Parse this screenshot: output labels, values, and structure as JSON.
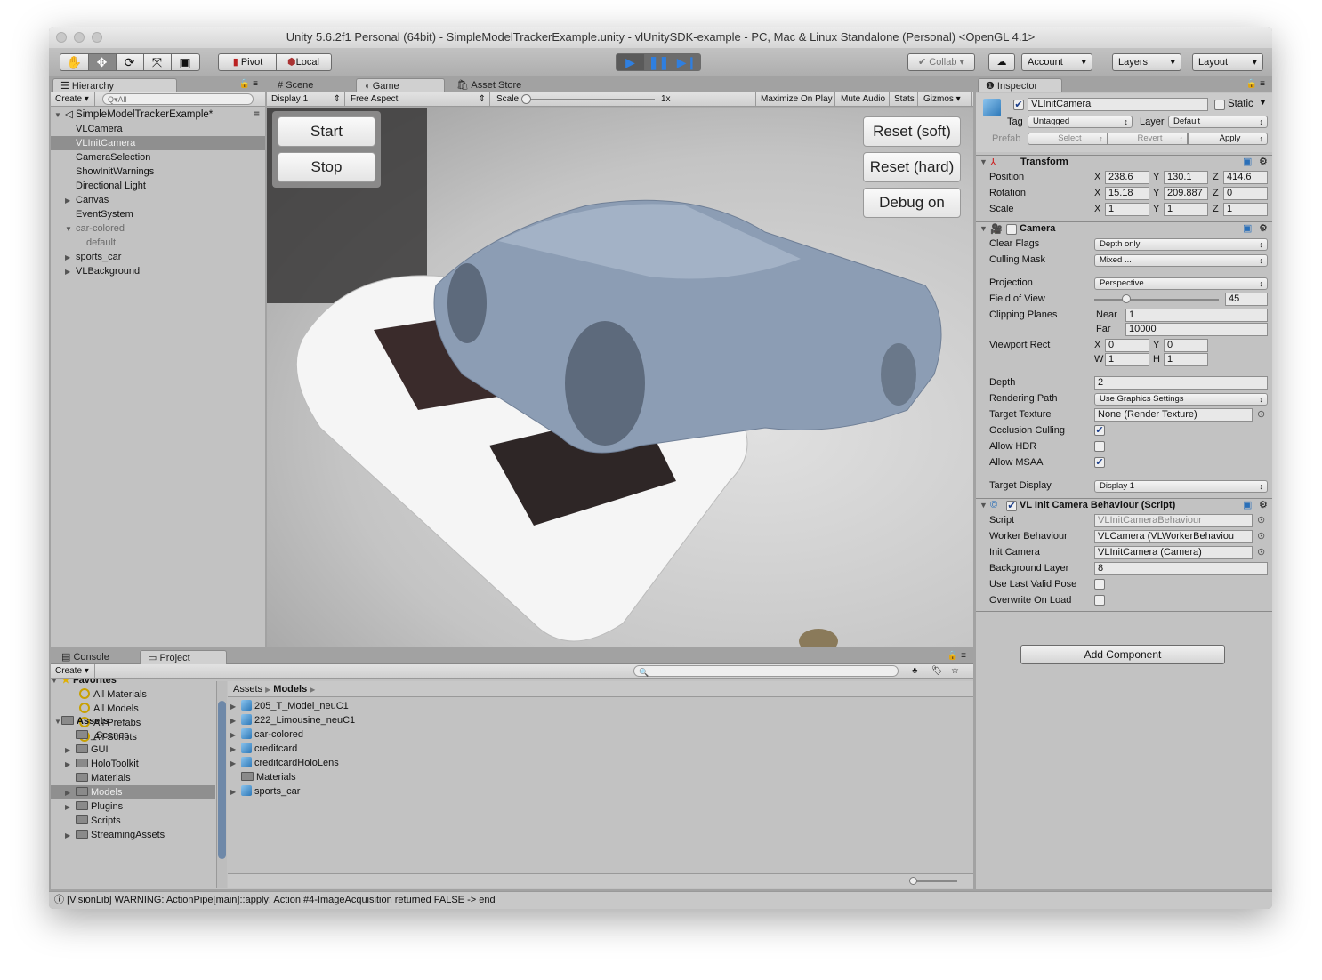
{
  "window": {
    "title": "Unity 5.6.2f1 Personal (64bit) - SimpleModelTrackerExample.unity - vlUnitySDK-example - PC, Mac & Linux Standalone (Personal) <OpenGL 4.1>"
  },
  "toolbar": {
    "tools": [
      "hand-icon",
      "move-icon",
      "rotate-icon",
      "scale-icon",
      "rect-icon"
    ],
    "pivot": "Pivot",
    "local": "Local",
    "collab": "Collab",
    "account": "Account",
    "layers": "Layers",
    "layout": "Layout",
    "accent": "#2f7fe0"
  },
  "hierarchy": {
    "tab": "Hierarchy",
    "create": "Create",
    "search_placeholder": "Q▾All",
    "scene": "SimpleModelTrackerExample*",
    "items": [
      {
        "label": "VLCamera",
        "indent": 1
      },
      {
        "label": "VLInitCamera",
        "indent": 1,
        "selected": true
      },
      {
        "label": "CameraSelection",
        "indent": 1
      },
      {
        "label": "ShowInitWarnings",
        "indent": 1
      },
      {
        "label": "Directional Light",
        "indent": 1
      },
      {
        "label": "Canvas",
        "indent": 1,
        "expandable": true
      },
      {
        "label": "EventSystem",
        "indent": 1
      },
      {
        "label": "car-colored",
        "indent": 1,
        "expanded": true,
        "gray": true
      },
      {
        "label": "default",
        "indent": 2,
        "gray": true
      },
      {
        "label": "sports_car",
        "indent": 1,
        "expandable": true
      },
      {
        "label": "VLBackground",
        "indent": 1,
        "expandable": true
      }
    ]
  },
  "game": {
    "tabs": [
      "Scene",
      "Game",
      "Asset Store"
    ],
    "display": "Display 1",
    "aspect": "Free Aspect",
    "scale_label": "Scale",
    "scale_value": "1x",
    "maximize": "Maximize On Play",
    "mute": "Mute Audio",
    "stats": "Stats",
    "gizmos": "Gizmos",
    "buttons_left": [
      "Start",
      "Stop"
    ],
    "buttons_right": [
      "Reset (soft)",
      "Reset (hard)",
      "Debug on"
    ]
  },
  "inspector": {
    "tab": "Inspector",
    "object_name": "VLInitCamera",
    "static": "Static",
    "tag_label": "Tag",
    "tag": "Untagged",
    "layer_label": "Layer",
    "layer": "Default",
    "prefab": "Prefab",
    "select": "Select",
    "revert": "Revert",
    "apply": "Apply",
    "transform": {
      "title": "Transform",
      "position": {
        "label": "Position",
        "x": "238.6",
        "y": "130.1",
        "z": "414.6"
      },
      "rotation": {
        "label": "Rotation",
        "x": "15.18",
        "y": "209.887",
        "z": "0"
      },
      "scale": {
        "label": "Scale",
        "x": "1",
        "y": "1",
        "z": "1"
      }
    },
    "camera": {
      "title": "Camera",
      "clear_flags": {
        "label": "Clear Flags",
        "value": "Depth only"
      },
      "culling_mask": {
        "label": "Culling Mask",
        "value": "Mixed ..."
      },
      "projection": {
        "label": "Projection",
        "value": "Perspective"
      },
      "fov": {
        "label": "Field of View",
        "value": "45"
      },
      "clipping": {
        "label": "Clipping Planes",
        "near_label": "Near",
        "near": "1",
        "far_label": "Far",
        "far": "10000"
      },
      "viewport": {
        "label": "Viewport Rect",
        "x": "0",
        "y": "0",
        "w": "1",
        "h": "1"
      },
      "depth": {
        "label": "Depth",
        "value": "2"
      },
      "rendering_path": {
        "label": "Rendering Path",
        "value": "Use Graphics Settings"
      },
      "target_texture": {
        "label": "Target Texture",
        "value": "None (Render Texture)"
      },
      "occlusion": {
        "label": "Occlusion Culling",
        "checked": true
      },
      "hdr": {
        "label": "Allow HDR",
        "checked": false
      },
      "msaa": {
        "label": "Allow MSAA",
        "checked": true
      },
      "target_display": {
        "label": "Target Display",
        "value": "Display 1"
      }
    },
    "script": {
      "title": "VL Init Camera Behaviour (Script)",
      "script": {
        "label": "Script",
        "value": "VLInitCameraBehaviour"
      },
      "worker": {
        "label": "Worker Behaviour",
        "value": "VLCamera (VLWorkerBehaviou"
      },
      "init_camera": {
        "label": "Init Camera",
        "value": "VLInitCamera (Camera)"
      },
      "bg_layer": {
        "label": "Background Layer",
        "value": "8"
      },
      "use_last": {
        "label": "Use Last Valid Pose",
        "checked": false
      },
      "overwrite": {
        "label": "Overwrite On Load",
        "checked": false
      }
    },
    "add_component": "Add Component"
  },
  "project": {
    "tabs": [
      "Console",
      "Project"
    ],
    "create": "Create",
    "favorites": "Favorites",
    "fav_items": [
      "All Materials",
      "All Models",
      "All Prefabs",
      "All Scripts"
    ],
    "assets": "Assets",
    "asset_folders": [
      {
        "label": "_Scenes"
      },
      {
        "label": "GUI",
        "expandable": true
      },
      {
        "label": "HoloToolkit",
        "expandable": true
      },
      {
        "label": "Materials"
      },
      {
        "label": "Models",
        "expandable": true,
        "selected": true
      },
      {
        "label": "Plugins",
        "expandable": true
      },
      {
        "label": "Scripts"
      },
      {
        "label": "StreamingAssets",
        "expandable": true
      }
    ],
    "breadcrumb": [
      "Assets",
      "Models"
    ],
    "contents": [
      {
        "label": "205_T_Model_neuC1",
        "type": "model"
      },
      {
        "label": "222_Limousine_neuC1",
        "type": "model"
      },
      {
        "label": "car-colored",
        "type": "model"
      },
      {
        "label": "creditcard",
        "type": "model"
      },
      {
        "label": "creditcardHoloLens",
        "type": "model"
      },
      {
        "label": "Materials",
        "type": "folder"
      },
      {
        "label": "sports_car",
        "type": "model"
      }
    ]
  },
  "status": {
    "message": "[VisionLib] WARNING: ActionPipe[main]::apply: Action #4-ImageAcquisition returned FALSE -> end"
  }
}
